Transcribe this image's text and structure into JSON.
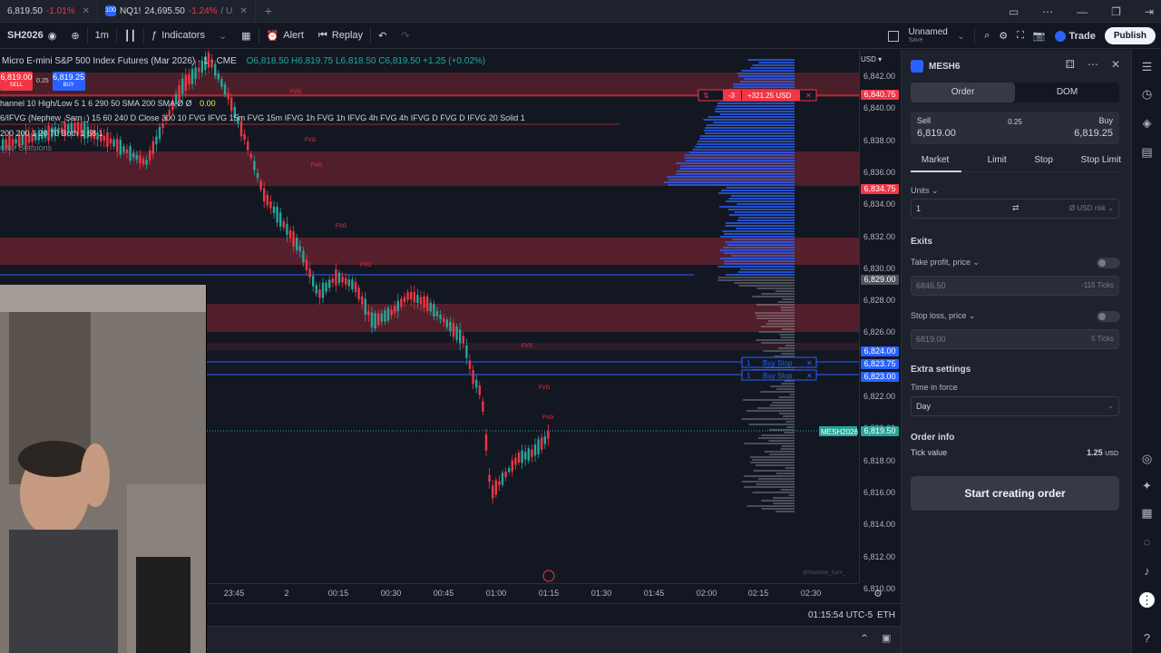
{
  "tabs": [
    {
      "symbol": "6,819.50",
      "change": "-1.01%"
    },
    {
      "badge": "100",
      "symbol": "NQ1!",
      "price": "24,695.50",
      "change": "-1.24%",
      "extra": "/ U"
    }
  ],
  "toolbar": {
    "symbol": "SH2026",
    "interval": "1m",
    "indicators": "Indicators",
    "alert": "Alert",
    "replay": "Replay",
    "layout_name": "Unnamed",
    "layout_sub": "Save",
    "trade": "Trade",
    "publish": "Publish"
  },
  "legend": {
    "title": "Micro E-mini S&P 500 Index Futures (Mar 2026) · 1 · CME",
    "ohlc": "O6,818.50 H6,819.75 L6,818.50 C6,819.50 +1.25 (+0.02%)",
    "ind1": "hannel 10 High/Low 5 1 6 290 50 SMA 200 SMA  Ø Ø",
    "ind1_val": "0.00",
    "ind2": "6/IFVG (Nephew_Sam_) 15 60 240 D Close 300 10 FVG IFVG 15m FVG 15m IFVG 1h FVG 1h IFVG 4h FVG 4h IFVG D FVG D IFVG 20 Solid 1",
    "ind3": "200 200 1 20 70 Both 1 68 1",
    "ind4": "ndar Sessions"
  },
  "quick": {
    "sell_price": "6,819.00",
    "sell_label": "SELL",
    "spread": "0.25",
    "buy_price": "6,819.25",
    "buy_label": "BUY"
  },
  "price_axis": {
    "currency": "USD",
    "ticks": [
      "6,842.00",
      "6,840.00",
      "6,838.00",
      "6,836.00",
      "6,834.00",
      "6,832.00",
      "6,830.00",
      "6,828.00",
      "6,826.00",
      "6,824.00",
      "6,822.00",
      "6,820.00",
      "6,818.00",
      "6,816.00",
      "6,814.00",
      "6,812.00",
      "6,810.00"
    ],
    "tags": [
      {
        "text": "6,840.75",
        "color": "#f23645"
      },
      {
        "text": "6,834.75",
        "color": "#f23645"
      },
      {
        "text": "6,829.00",
        "color": "#50535e"
      },
      {
        "text": "6,824.00",
        "color": "#2962ff"
      },
      {
        "text": "6,823.75",
        "color": "#2962ff"
      },
      {
        "text": "6,823.00",
        "color": "#2962ff"
      },
      {
        "text": "6,819.50",
        "color": "#26a69a"
      }
    ]
  },
  "time_axis": [
    "23:45",
    "2",
    "00:15",
    "00:30",
    "00:45",
    "01:00",
    "01:15",
    "01:30",
    "01:45",
    "02:00",
    "02:15",
    "02:30"
  ],
  "chart_labels": {
    "position_qty": "-3",
    "position_pnl": "+321.25 USD",
    "buy_stop_1_qty": "1",
    "buy_stop_1": "Buy Stop",
    "buy_stop_2_qty": "1",
    "buy_stop_2": "Buy Stop",
    "symbol_tag": "MESH2026",
    "fvg": "FVG",
    "watermark": "@Nephew_Sam_"
  },
  "status": {
    "time": "01:15:54 UTC-5",
    "session": "ETH"
  },
  "panel": {
    "symbol": "MESH6",
    "tabs": [
      "Order",
      "DOM"
    ],
    "sell_label": "Sell",
    "sell_price": "6,819.00",
    "spread": "0.25",
    "buy_label": "Buy",
    "buy_price": "6,819.25",
    "order_types": [
      "Market",
      "Limit",
      "Stop",
      "Stop Limit"
    ],
    "units_label": "Units",
    "units_value": "1",
    "risk_label": "USD risk",
    "exits": "Exits",
    "tp_label": "Take profit, price",
    "tp_value": "6846.50",
    "tp_ticks": "-115 Ticks",
    "sl_label": "Stop loss, price",
    "sl_value": "6819.00",
    "sl_ticks": "5 Ticks",
    "extra": "Extra settings",
    "tif_label": "Time in force",
    "tif_value": "Day",
    "info": "Order info",
    "tick_label": "Tick value",
    "tick_value": "1.25",
    "tick_unit": "USD",
    "start": "Start creating order"
  },
  "colors": {
    "bull": "#26a69a",
    "bear": "#f23645",
    "accent": "#2962ff",
    "fvg": "rgba(242,54,69,0.28)"
  }
}
